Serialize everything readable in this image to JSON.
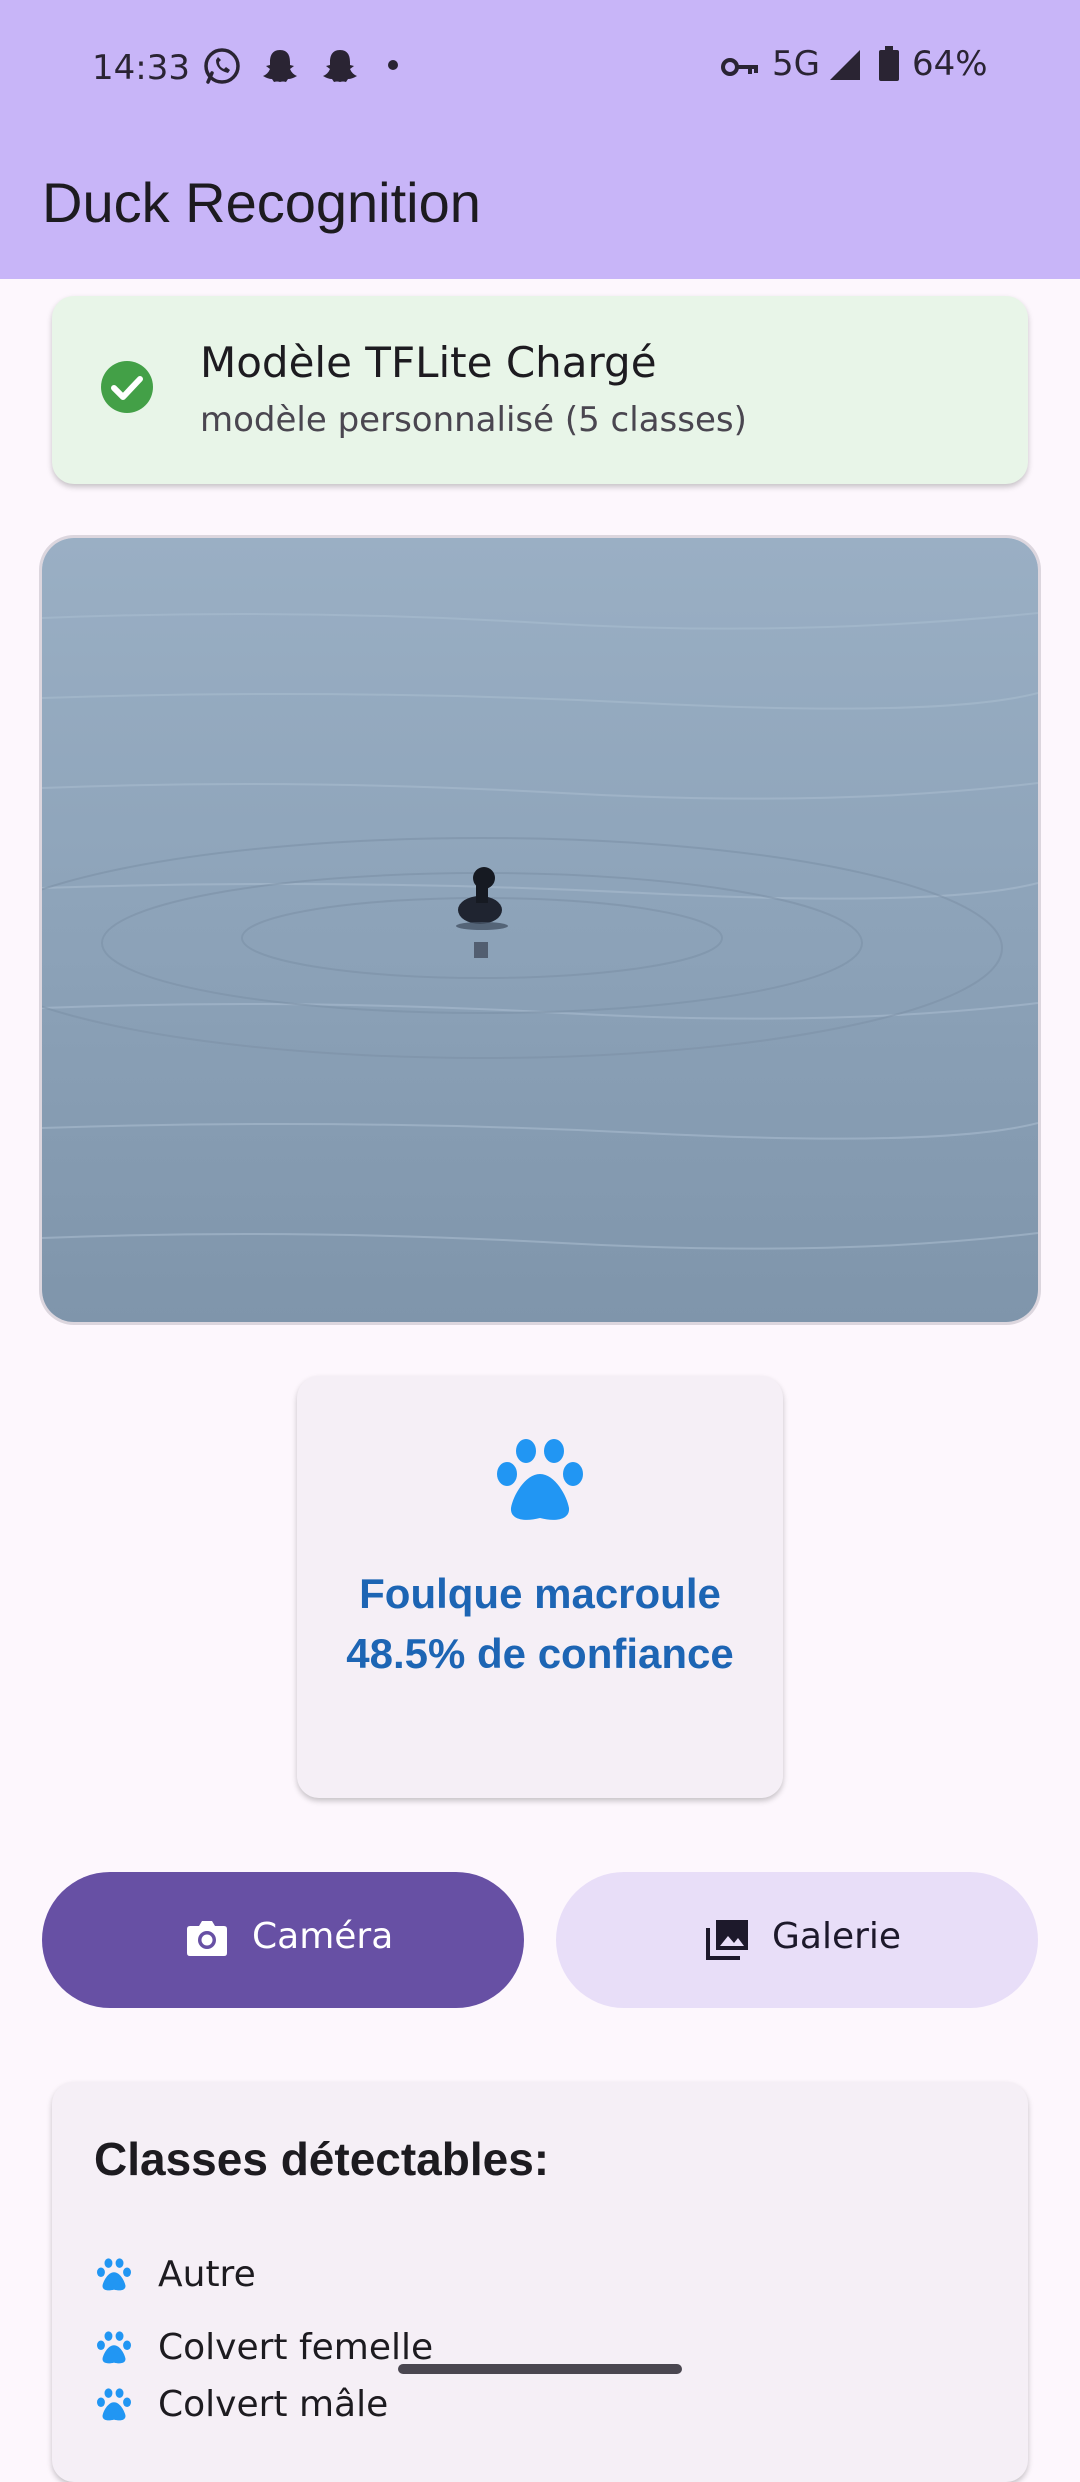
{
  "status_bar": {
    "time": "14:33",
    "network": "5G",
    "battery": "64%"
  },
  "app_bar": {
    "title": "Duck Recognition"
  },
  "model_status": {
    "title": "Modèle TFLite Chargé",
    "subtitle": "modèle personnalisé (5 classes)",
    "icon": "check-circle-icon",
    "color": "#43a047"
  },
  "result": {
    "icon": "paw-icon",
    "label": "Foulque macroule",
    "confidence": "48.5% de confiance",
    "color": "#1d65b4"
  },
  "buttons": {
    "camera_label": "Caméra",
    "gallery_label": "Galerie"
  },
  "classes": {
    "title": "Classes détectables:",
    "items": [
      {
        "label": "Autre"
      },
      {
        "label": "Colvert femelle"
      },
      {
        "label": "Colvert mâle"
      }
    ]
  },
  "colors": {
    "app_bar": "#c8b5f8",
    "primary": "#6750a4",
    "secondary_container": "#e8def8",
    "accent_blue": "#2196f3"
  }
}
